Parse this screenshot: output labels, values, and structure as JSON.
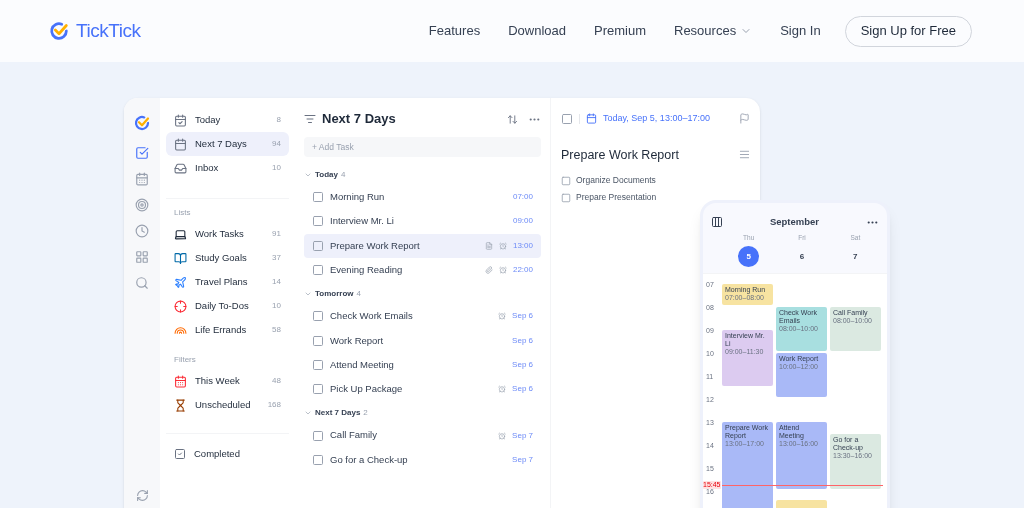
{
  "nav": {
    "brand": "TickTick",
    "links": [
      {
        "label": "Features",
        "dropdown": false
      },
      {
        "label": "Download",
        "dropdown": false
      },
      {
        "label": "Premium",
        "dropdown": false
      },
      {
        "label": "Resources",
        "dropdown": true
      },
      {
        "label": "Sign In",
        "dropdown": false
      }
    ],
    "cta": "Sign Up for Free"
  },
  "rail": [
    {
      "kind": "task",
      "selected": true
    },
    {
      "kind": "calendar",
      "selected": false
    },
    {
      "kind": "focus",
      "selected": false
    },
    {
      "kind": "clock",
      "selected": false
    },
    {
      "kind": "apps",
      "selected": false
    },
    {
      "kind": "search",
      "selected": false
    }
  ],
  "sidebar": {
    "smart": [
      {
        "label": "Today",
        "count": "8",
        "kind": "today",
        "selected": false
      },
      {
        "label": "Next 7 Days",
        "count": "94",
        "kind": "week",
        "selected": true
      },
      {
        "label": "Inbox",
        "count": "10",
        "kind": "inbox",
        "selected": false
      }
    ],
    "lists_title": "Lists",
    "lists": [
      {
        "label": "Work Tasks",
        "count": "91",
        "kind": "laptop",
        "selected": false
      },
      {
        "label": "Study Goals",
        "count": "37",
        "kind": "book",
        "selected": false
      },
      {
        "label": "Travel Plans",
        "count": "14",
        "kind": "plane",
        "selected": false
      },
      {
        "label": "Daily To-Dos",
        "count": "10",
        "kind": "target",
        "selected": false
      },
      {
        "label": "Life Errands",
        "count": "58",
        "kind": "rainbow",
        "selected": false
      }
    ],
    "filters_title": "Filters",
    "filters": [
      {
        "label": "This Week",
        "count": "48",
        "kind": "calendar",
        "selected": false
      },
      {
        "label": "Unscheduled",
        "count": "168",
        "kind": "hourglass",
        "selected": false
      }
    ],
    "completed": "Completed"
  },
  "tasks": {
    "title": "Next 7 Days",
    "add_placeholder": "+ Add Task",
    "groups": [
      {
        "title": "Today",
        "count": "4",
        "expanded": true,
        "items": [
          {
            "title": "Morning Run",
            "due": "07:00",
            "selected": false,
            "checked": false,
            "note": false,
            "attachment": false,
            "alarm": false
          },
          {
            "title": "Interview Mr. Li",
            "due": "09:00",
            "selected": false,
            "checked": false,
            "note": false,
            "attachment": false,
            "alarm": false
          },
          {
            "title": "Prepare Work Report",
            "due": "13:00",
            "selected": true,
            "checked": false,
            "note": true,
            "attachment": false,
            "alarm": true
          },
          {
            "title": "Evening Reading",
            "due": "22:00",
            "selected": false,
            "checked": false,
            "note": false,
            "attachment": true,
            "alarm": true
          }
        ]
      },
      {
        "title": "Tomorrow",
        "count": "4",
        "expanded": true,
        "items": [
          {
            "title": "Check Work Emails",
            "due": "Sep 6",
            "selected": false,
            "checked": false,
            "note": false,
            "attachment": false,
            "alarm": true
          },
          {
            "title": "Work Report",
            "due": "Sep 6",
            "selected": false,
            "checked": false,
            "note": false,
            "attachment": false,
            "alarm": false
          },
          {
            "title": "Attend Meeting",
            "due": "Sep 6",
            "selected": false,
            "checked": false,
            "note": false,
            "attachment": false,
            "alarm": false
          },
          {
            "title": "Pick Up Package",
            "due": "Sep 6",
            "selected": false,
            "checked": false,
            "note": false,
            "attachment": false,
            "alarm": true
          }
        ]
      },
      {
        "title": "Next 7 Days",
        "count": "2",
        "expanded": true,
        "items": [
          {
            "title": "Call Family",
            "due": "Sep 7",
            "selected": false,
            "checked": false,
            "note": false,
            "attachment": false,
            "alarm": true
          },
          {
            "title": "Go for a Check-up",
            "due": "Sep 7",
            "selected": false,
            "checked": false,
            "note": false,
            "attachment": false,
            "alarm": false
          }
        ]
      }
    ]
  },
  "detail": {
    "checked": false,
    "date": "Today, Sep 5, 13:00–17:00",
    "title": "Prepare Work Report",
    "subtasks": [
      {
        "title": "Organize Documents",
        "checked": false
      },
      {
        "title": "Prepare Presentation",
        "checked": false
      }
    ]
  },
  "calendar": {
    "month": "September",
    "days": [
      {
        "weekday": "Thu",
        "date": "5",
        "selected": true
      },
      {
        "weekday": "Fri",
        "date": "6",
        "selected": false
      },
      {
        "weekday": "Sat",
        "date": "7",
        "selected": false
      }
    ],
    "hours": [
      "07",
      "08",
      "09",
      "10",
      "11",
      "12",
      "13",
      "14",
      "15",
      "16"
    ],
    "now": "15:45",
    "events": [
      {
        "title": "Morning Run",
        "time": "07:00–08:00",
        "color": "#f7e3a1"
      },
      {
        "title": "Interview Mr. Li",
        "time": "09:00–11:30",
        "color": "#dccbf0"
      },
      {
        "title": "Prepare Work Report",
        "time": "13:00–17:00",
        "color": "#a9b9f7"
      },
      {
        "title": "Check Work Emails",
        "time": "08:00–10:00",
        "color": "#a8dfe0"
      },
      {
        "title": "Work Report",
        "time": "10:00–12:00",
        "color": "#a9b9f7"
      },
      {
        "title": "Attend Meeting",
        "time": "13:00–16:00",
        "color": "#a9b9f7"
      },
      {
        "color": "#f7e3a1"
      },
      {
        "title": "Call Family",
        "time": "08:00–10:00",
        "color": "#dbe9e1"
      },
      {
        "title": "Go for a Check-up",
        "time": "13:30–16:00",
        "color": "#dbe9e1"
      }
    ]
  }
}
